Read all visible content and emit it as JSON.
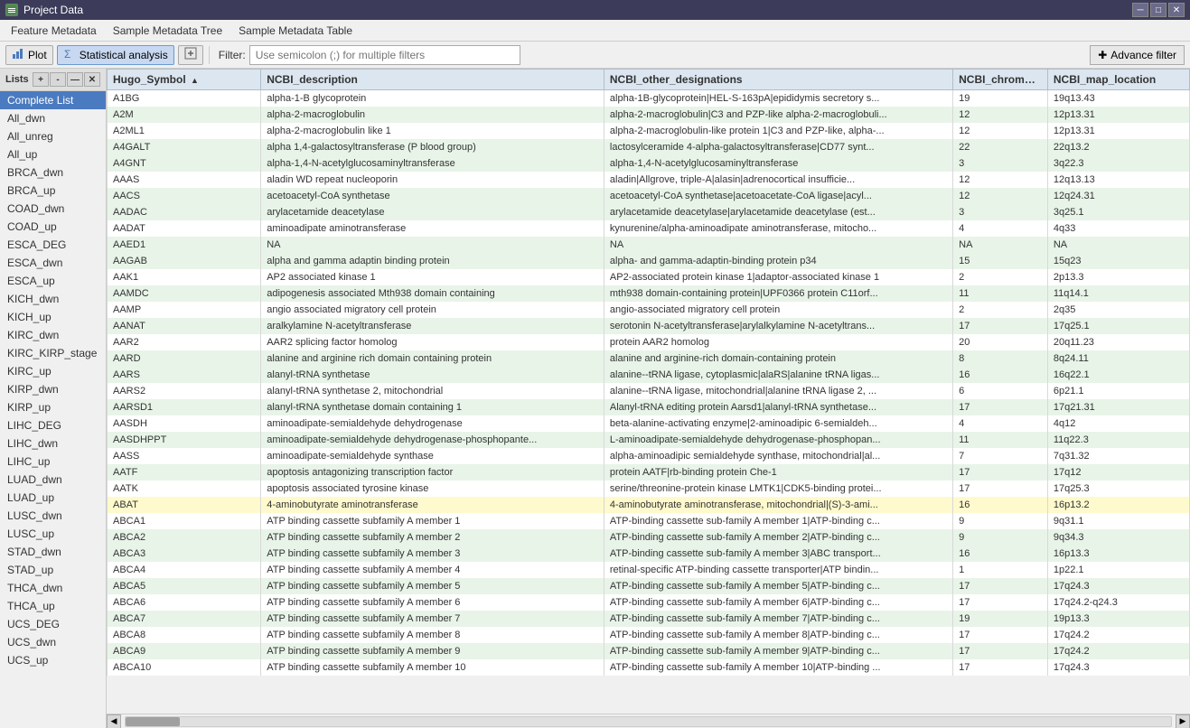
{
  "window": {
    "title": "Project Data",
    "controls": [
      "minimize",
      "maximize",
      "close"
    ]
  },
  "menu": {
    "items": [
      "Feature Metadata",
      "Sample Metadata Tree",
      "Sample Metadata Table"
    ]
  },
  "toolbar": {
    "plot_label": "Plot",
    "stats_label": "Statistical analysis",
    "filter_label": "Filter:",
    "filter_placeholder": "Use semicolon (;) for multiple filters",
    "advance_filter_label": "Advance filter"
  },
  "sidebar": {
    "header_label": "Lists",
    "btn_add": "+",
    "btn_minus": "-",
    "btn_settings": "⚙",
    "btn_x": "✕",
    "items": [
      {
        "label": "Complete List",
        "active": true
      },
      {
        "label": "All_dwn"
      },
      {
        "label": "All_unreg"
      },
      {
        "label": "All_up"
      },
      {
        "label": "BRCA_dwn"
      },
      {
        "label": "BRCA_up"
      },
      {
        "label": "COAD_dwn"
      },
      {
        "label": "COAD_up"
      },
      {
        "label": "ESCA_DEG"
      },
      {
        "label": "ESCA_dwn"
      },
      {
        "label": "ESCA_up"
      },
      {
        "label": "KICH_dwn"
      },
      {
        "label": "KICH_up"
      },
      {
        "label": "KIRC_dwn"
      },
      {
        "label": "KIRC_KIRP_stage"
      },
      {
        "label": "KIRC_up"
      },
      {
        "label": "KIRP_dwn"
      },
      {
        "label": "KIRP_up"
      },
      {
        "label": "LIHC_DEG"
      },
      {
        "label": "LIHC_dwn"
      },
      {
        "label": "LIHC_up"
      },
      {
        "label": "LUAD_dwn"
      },
      {
        "label": "LUAD_up"
      },
      {
        "label": "LUSC_dwn"
      },
      {
        "label": "LUSC_up"
      },
      {
        "label": "STAD_dwn"
      },
      {
        "label": "STAD_up"
      },
      {
        "label": "THCA_dwn"
      },
      {
        "label": "THCA_up"
      },
      {
        "label": "UCS_DEG"
      },
      {
        "label": "UCS_dwn"
      },
      {
        "label": "UCS_up"
      }
    ]
  },
  "table": {
    "columns": [
      {
        "id": "hugo",
        "label": "Hugo_Symbol",
        "sort": "asc"
      },
      {
        "id": "ncbi_desc",
        "label": "NCBI_description"
      },
      {
        "id": "ncbi_other",
        "label": "NCBI_other_designations"
      },
      {
        "id": "ncbi_chr",
        "label": "NCBI_chromosome"
      },
      {
        "id": "ncbi_map",
        "label": "NCBI_map_location"
      }
    ],
    "rows": [
      {
        "hugo": "A1BG",
        "ncbi_desc": "alpha-1-B glycoprotein",
        "ncbi_other": "alpha-1B-glycoprotein|HEL-S-163pA|epididymis secretory s...",
        "ncbi_chr": "19",
        "ncbi_map": "19q13.43"
      },
      {
        "hugo": "A2M",
        "ncbi_desc": "alpha-2-macroglobulin",
        "ncbi_other": "alpha-2-macroglobulin|C3 and PZP-like alpha-2-macroglobuli...",
        "ncbi_chr": "12",
        "ncbi_map": "12p13.31"
      },
      {
        "hugo": "A2ML1",
        "ncbi_desc": "alpha-2-macroglobulin like 1",
        "ncbi_other": "alpha-2-macroglobulin-like protein 1|C3 and PZP-like, alpha-...",
        "ncbi_chr": "12",
        "ncbi_map": "12p13.31"
      },
      {
        "hugo": "A4GALT",
        "ncbi_desc": "alpha 1,4-galactosyltransferase (P blood group)",
        "ncbi_other": "lactosylceramide 4-alpha-galactosyltransferase|CD77 synt...",
        "ncbi_chr": "22",
        "ncbi_map": "22q13.2"
      },
      {
        "hugo": "A4GNT",
        "ncbi_desc": "alpha-1,4-N-acetylglucosaminyltransferase",
        "ncbi_other": "alpha-1,4-N-acetylglucosaminyltransferase",
        "ncbi_chr": "3",
        "ncbi_map": "3q22.3"
      },
      {
        "hugo": "AAAS",
        "ncbi_desc": "aladin WD repeat nucleoporin",
        "ncbi_other": "aladin|Allgrove, triple-A|alasin|adrenocortical insufficie...",
        "ncbi_chr": "12",
        "ncbi_map": "12q13.13"
      },
      {
        "hugo": "AACS",
        "ncbi_desc": "acetoacetyl-CoA synthetase",
        "ncbi_other": "acetoacetyl-CoA synthetase|acetoacetate-CoA ligase|acyl...",
        "ncbi_chr": "12",
        "ncbi_map": "12q24.31"
      },
      {
        "hugo": "AADAC",
        "ncbi_desc": "arylacetamide deacetylase",
        "ncbi_other": "arylacetamide deacetylase|arylacetamide deacetylase (est...",
        "ncbi_chr": "3",
        "ncbi_map": "3q25.1"
      },
      {
        "hugo": "AADAT",
        "ncbi_desc": "aminoadipate aminotransferase",
        "ncbi_other": "kynurenine/alpha-aminoadipate aminotransferase, mitocho...",
        "ncbi_chr": "4",
        "ncbi_map": "4q33"
      },
      {
        "hugo": "AAED1",
        "ncbi_desc": "NA",
        "ncbi_other": "NA",
        "ncbi_chr": "NA",
        "ncbi_map": "NA"
      },
      {
        "hugo": "AAGAB",
        "ncbi_desc": "alpha and gamma adaptin binding protein",
        "ncbi_other": "alpha- and gamma-adaptin-binding protein p34",
        "ncbi_chr": "15",
        "ncbi_map": "15q23"
      },
      {
        "hugo": "AAK1",
        "ncbi_desc": "AP2 associated kinase 1",
        "ncbi_other": "AP2-associated protein kinase 1|adaptor-associated kinase 1",
        "ncbi_chr": "2",
        "ncbi_map": "2p13.3"
      },
      {
        "hugo": "AAMDC",
        "ncbi_desc": "adipogenesis associated Mth938 domain containing",
        "ncbi_other": "mth938 domain-containing protein|UPF0366 protein C11orf...",
        "ncbi_chr": "11",
        "ncbi_map": "11q14.1"
      },
      {
        "hugo": "AAMP",
        "ncbi_desc": "angio associated migratory cell protein",
        "ncbi_other": "angio-associated migratory cell protein",
        "ncbi_chr": "2",
        "ncbi_map": "2q35"
      },
      {
        "hugo": "AANAT",
        "ncbi_desc": "aralkylamine N-acetyltransferase",
        "ncbi_other": "serotonin N-acetyltransferase|arylalkylamine N-acetyltrans...",
        "ncbi_chr": "17",
        "ncbi_map": "17q25.1"
      },
      {
        "hugo": "AAR2",
        "ncbi_desc": "AAR2 splicing factor homolog",
        "ncbi_other": "protein AAR2 homolog",
        "ncbi_chr": "20",
        "ncbi_map": "20q11.23"
      },
      {
        "hugo": "AARD",
        "ncbi_desc": "alanine and arginine rich domain containing protein",
        "ncbi_other": "alanine and arginine-rich domain-containing protein",
        "ncbi_chr": "8",
        "ncbi_map": "8q24.11"
      },
      {
        "hugo": "AARS",
        "ncbi_desc": "alanyl-tRNA synthetase",
        "ncbi_other": "alanine--tRNA ligase, cytoplasmic|alaRS|alanine tRNA ligas...",
        "ncbi_chr": "16",
        "ncbi_map": "16q22.1"
      },
      {
        "hugo": "AARS2",
        "ncbi_desc": "alanyl-tRNA synthetase 2, mitochondrial",
        "ncbi_other": "alanine--tRNA ligase, mitochondrial|alanine tRNA ligase 2, ...",
        "ncbi_chr": "6",
        "ncbi_map": "6p21.1"
      },
      {
        "hugo": "AARSD1",
        "ncbi_desc": "alanyl-tRNA synthetase domain containing 1",
        "ncbi_other": "Alanyl-tRNA editing protein Aarsd1|alanyl-tRNA synthetase...",
        "ncbi_chr": "17",
        "ncbi_map": "17q21.31"
      },
      {
        "hugo": "AASDH",
        "ncbi_desc": "aminoadipate-semialdehyde dehydrogenase",
        "ncbi_other": "beta-alanine-activating enzyme|2-aminoadipic 6-semialdeh...",
        "ncbi_chr": "4",
        "ncbi_map": "4q12"
      },
      {
        "hugo": "AASDHPPT",
        "ncbi_desc": "aminoadipate-semialdehyde dehydrogenase-phosphopante...",
        "ncbi_other": "L-aminoadipate-semialdehyde dehydrogenase-phosphopan...",
        "ncbi_chr": "11",
        "ncbi_map": "11q22.3"
      },
      {
        "hugo": "AASS",
        "ncbi_desc": "aminoadipate-semialdehyde synthase",
        "ncbi_other": "alpha-aminoadipic semialdehyde synthase, mitochondrial|al...",
        "ncbi_chr": "7",
        "ncbi_map": "7q31.32"
      },
      {
        "hugo": "AATF",
        "ncbi_desc": "apoptosis antagonizing transcription factor",
        "ncbi_other": "protein AATF|rb-binding protein Che-1",
        "ncbi_chr": "17",
        "ncbi_map": "17q12"
      },
      {
        "hugo": "AATK",
        "ncbi_desc": "apoptosis associated tyrosine kinase",
        "ncbi_other": "serine/threonine-protein kinase LMTK1|CDK5-binding protei...",
        "ncbi_chr": "17",
        "ncbi_map": "17q25.3"
      },
      {
        "hugo": "ABAT",
        "ncbi_desc": "4-aminobutyrate aminotransferase",
        "ncbi_other": "4-aminobutyrate aminotransferase, mitochondrial|(S)-3-ami...",
        "ncbi_chr": "16",
        "ncbi_map": "16p13.2"
      },
      {
        "hugo": "ABCA1",
        "ncbi_desc": "ATP binding cassette subfamily A member 1",
        "ncbi_other": "ATP-binding cassette sub-family A member 1|ATP-binding c...",
        "ncbi_chr": "9",
        "ncbi_map": "9q31.1"
      },
      {
        "hugo": "ABCA2",
        "ncbi_desc": "ATP binding cassette subfamily A member 2",
        "ncbi_other": "ATP-binding cassette sub-family A member 2|ATP-binding c...",
        "ncbi_chr": "9",
        "ncbi_map": "9q34.3"
      },
      {
        "hugo": "ABCA3",
        "ncbi_desc": "ATP binding cassette subfamily A member 3",
        "ncbi_other": "ATP-binding cassette sub-family A member 3|ABC transport...",
        "ncbi_chr": "16",
        "ncbi_map": "16p13.3"
      },
      {
        "hugo": "ABCA4",
        "ncbi_desc": "ATP binding cassette subfamily A member 4",
        "ncbi_other": "retinal-specific ATP-binding cassette transporter|ATP bindin...",
        "ncbi_chr": "1",
        "ncbi_map": "1p22.1"
      },
      {
        "hugo": "ABCA5",
        "ncbi_desc": "ATP binding cassette subfamily A member 5",
        "ncbi_other": "ATP-binding cassette sub-family A member 5|ATP-binding c...",
        "ncbi_chr": "17",
        "ncbi_map": "17q24.3"
      },
      {
        "hugo": "ABCA6",
        "ncbi_desc": "ATP binding cassette subfamily A member 6",
        "ncbi_other": "ATP-binding cassette sub-family A member 6|ATP-binding c...",
        "ncbi_chr": "17",
        "ncbi_map": "17q24.2-q24.3"
      },
      {
        "hugo": "ABCA7",
        "ncbi_desc": "ATP binding cassette subfamily A member 7",
        "ncbi_other": "ATP-binding cassette sub-family A member 7|ATP-binding c...",
        "ncbi_chr": "19",
        "ncbi_map": "19p13.3"
      },
      {
        "hugo": "ABCA8",
        "ncbi_desc": "ATP binding cassette subfamily A member 8",
        "ncbi_other": "ATP-binding cassette sub-family A member 8|ATP-binding c...",
        "ncbi_chr": "17",
        "ncbi_map": "17q24.2"
      },
      {
        "hugo": "ABCA9",
        "ncbi_desc": "ATP binding cassette subfamily A member 9",
        "ncbi_other": "ATP-binding cassette sub-family A member 9|ATP-binding c...",
        "ncbi_chr": "17",
        "ncbi_map": "17q24.2"
      },
      {
        "hugo": "ABCA10",
        "ncbi_desc": "ATP binding cassette subfamily A member 10",
        "ncbi_other": "ATP-binding cassette sub-family A member 10|ATP-binding ...",
        "ncbi_chr": "17",
        "ncbi_map": "17q24.3"
      }
    ]
  },
  "colors": {
    "row_even": "#e8f4e8",
    "row_odd": "#ffffff",
    "row_highlight": "#fffacd",
    "header_bg": "#dce6f0",
    "selected_bg": "#4a7abf",
    "accent": "#4a7abf"
  }
}
